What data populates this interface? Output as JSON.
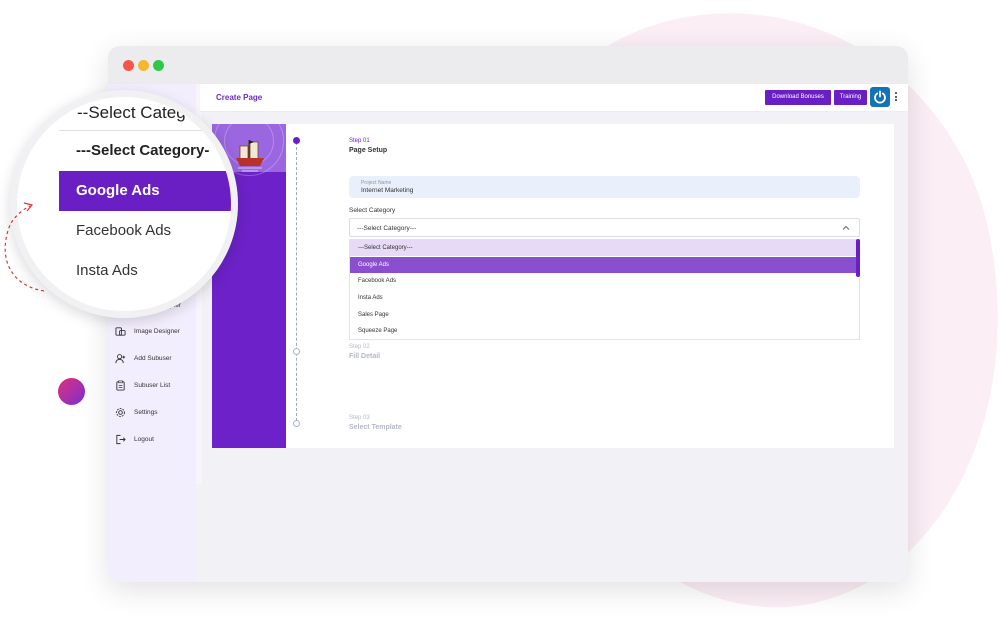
{
  "window": {
    "controls": [
      "close",
      "minimize",
      "maximize"
    ]
  },
  "header": {
    "title": "Create Page",
    "download_bonuses": "Download Bonuses",
    "training": "Training",
    "power_icon": "power-icon",
    "menu_icon": "kebab-menu-icon"
  },
  "steps": [
    {
      "num": "Step 01",
      "title": "Page Setup"
    },
    {
      "num": "Step 02",
      "title": "Fill Detail"
    },
    {
      "num": "Step 03",
      "title": "Select Template"
    }
  ],
  "form": {
    "project_name_label": "Project Name",
    "project_name_value": "Internet Marketing",
    "category_label": "Select Category",
    "category_value": "---Select Category---"
  },
  "dropdown": {
    "options": [
      "---Select Category---",
      "Google Ads",
      "Facebook Ads",
      "Insta Ads",
      "Sales Page",
      "Squeeze Page"
    ],
    "highlighted": "Google Ads"
  },
  "sidebar": {
    "items": [
      {
        "label": "Image Designer",
        "icon": "image-icon"
      },
      {
        "label": "Add Subuser",
        "icon": "add-user-icon"
      },
      {
        "label": "Subuser List",
        "icon": "clipboard-icon"
      },
      {
        "label": "Settings",
        "icon": "gear-icon"
      },
      {
        "label": "Logout",
        "icon": "logout-icon"
      }
    ],
    "partial_label": "gner"
  },
  "magnifier": {
    "top_text": "--Select Categ",
    "items": [
      "---Select Category-",
      "Google Ads",
      "Facebook Ads",
      "Insta Ads"
    ]
  },
  "colors": {
    "brand_purple": "#6a1fc5",
    "highlight_purple": "#8a4fcf",
    "power_blue": "#1473b8"
  }
}
